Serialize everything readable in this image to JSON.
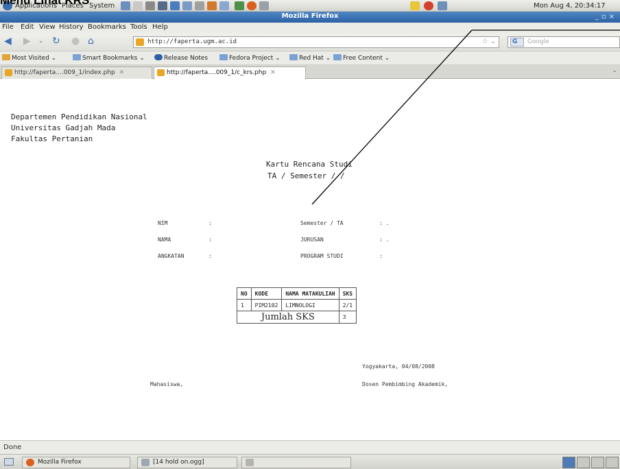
{
  "caption": "Menu Lihat KRS",
  "top_panel": {
    "menus": [
      "Applications",
      "Places",
      "System"
    ],
    "clock": "Mon Aug  4, 20:34:17"
  },
  "window": {
    "title": "Mozilla Firefox"
  },
  "menubar": [
    "File",
    "Edit",
    "View",
    "History",
    "Bookmarks",
    "Tools",
    "Help"
  ],
  "toolbar": {
    "url": "http://faperta.ugm.ac.id",
    "search_placeholder": "Google",
    "search_engine_label": "G"
  },
  "bookmarks": [
    "Most Visited",
    "Smart Bookmarks",
    "Release Notes",
    "Fedora Project",
    "Red Hat",
    "Free Content"
  ],
  "tabs": [
    {
      "label": "http://faperta....009_1/index.php",
      "active": false
    },
    {
      "label": "http://faperta....009_1/c_krs.php",
      "active": true
    }
  ],
  "page": {
    "header": [
      "Departemen Pendidikan Nasional",
      "Universitas Gadjah Mada",
      "Fakultas Pertanian"
    ],
    "title": "Kartu Rencana Studi",
    "subtitle": "TA / Semester  /  /",
    "fields_left": [
      {
        "label": "NIM",
        "value": ":"
      },
      {
        "label": "NAMA",
        "value": ":"
      },
      {
        "label": "ANGKATAN",
        "value": ":"
      }
    ],
    "fields_right": [
      {
        "label": "Semester / TA",
        "value": ": ."
      },
      {
        "label": "JURUSAN",
        "value": ": ."
      },
      {
        "label": "PROGRAM STUDI",
        "value": ":"
      }
    ],
    "table": {
      "headers": [
        "NO",
        "KODE",
        "NAMA MATAKULIAH",
        "SKS"
      ],
      "rows": [
        [
          "1",
          "PIM2102",
          "LIMNOLOGI",
          "2/1"
        ]
      ],
      "total_label": "Jumlah SKS",
      "total_value": "3"
    },
    "place_date": "Yogyakarta, 04/08/2008",
    "sig_left": "Mahasiswa,",
    "sig_right": "Dosen Pembimbing Akademik,"
  },
  "status": "Done",
  "taskbar": [
    "Mozilla Firefox",
    "[14 hold on.ogg]"
  ]
}
